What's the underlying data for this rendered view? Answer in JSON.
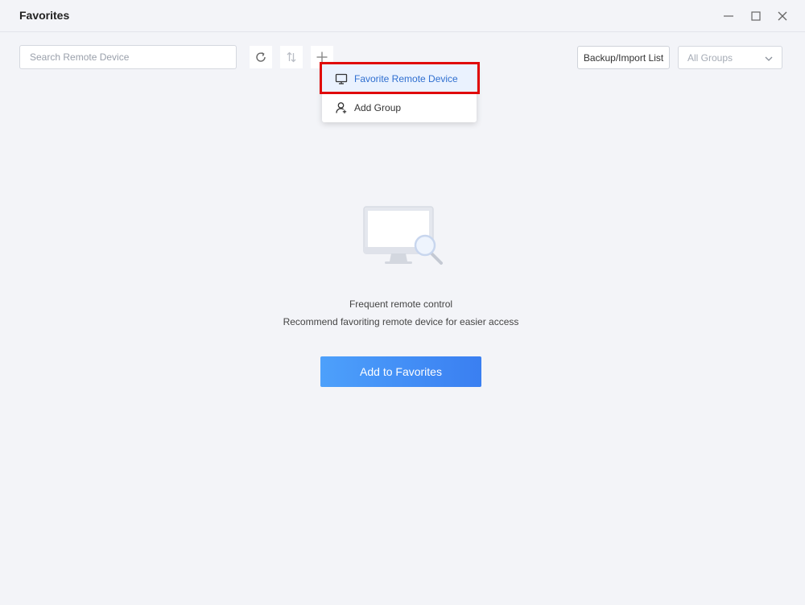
{
  "window": {
    "title": "Favorites",
    "controls": [
      "minimize-icon",
      "maximize-icon",
      "close-icon"
    ]
  },
  "toolbar": {
    "search_placeholder": "Search Remote Device",
    "search_value": "",
    "tools": [
      "refresh-icon",
      "sort-icon",
      "plus-icon"
    ],
    "backup_label": "Backup/Import List",
    "groups_selected": "All Groups"
  },
  "menu": {
    "items": [
      {
        "label": "Favorite Remote Device",
        "icon": "monitor-icon",
        "active": true
      },
      {
        "label": "Add Group",
        "icon": "user-add-icon",
        "active": false
      }
    ]
  },
  "empty_state": {
    "illustration": "monitor-search-icon",
    "title": "Frequent remote control",
    "subtitle": "Recommend favoriting remote device for easier access",
    "button_label": "Add to Favorites"
  },
  "colors": {
    "accent": "#3a85f5",
    "highlight_border": "#e00a0a",
    "active_item_bg": "#eaf2fe",
    "background": "#f3f4f8"
  }
}
